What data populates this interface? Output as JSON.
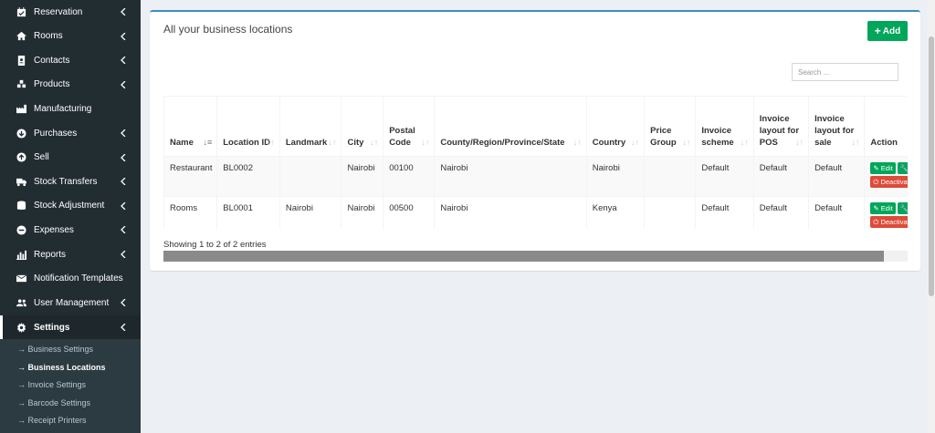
{
  "sidebar": {
    "items": [
      {
        "label": "Reservation",
        "icon": "calendar-check-icon"
      },
      {
        "label": "Rooms",
        "icon": "home-icon"
      },
      {
        "label": "Contacts",
        "icon": "address-book-icon"
      },
      {
        "label": "Products",
        "icon": "cubes-icon"
      },
      {
        "label": "Manufacturing",
        "icon": "industry-icon"
      },
      {
        "label": "Purchases",
        "icon": "arrow-circle-down-icon"
      },
      {
        "label": "Sell",
        "icon": "arrow-circle-up-icon"
      },
      {
        "label": "Stock Transfers",
        "icon": "truck-icon"
      },
      {
        "label": "Stock Adjustment",
        "icon": "database-icon"
      },
      {
        "label": "Expenses",
        "icon": "minus-circle-icon"
      },
      {
        "label": "Reports",
        "icon": "bar-chart-icon"
      },
      {
        "label": "Notification Templates",
        "icon": "envelope-icon"
      },
      {
        "label": "User Management",
        "icon": "users-icon"
      },
      {
        "label": "Settings",
        "icon": "cog-icon"
      }
    ],
    "subitems": [
      {
        "label": "→ Business Settings"
      },
      {
        "label": "→ Business Locations"
      },
      {
        "label": "→ Invoice Settings"
      },
      {
        "label": "→ Barcode Settings"
      },
      {
        "label": "→ Receipt Printers"
      }
    ]
  },
  "page": {
    "title": "All your business locations",
    "add_label": "Add",
    "search_placeholder": "Search ..."
  },
  "table": {
    "headers": [
      "Name",
      "Location ID",
      "Landmark",
      "City",
      "Postal Code",
      "County/Region/Province/State",
      "Country",
      "Price Group",
      "Invoice scheme",
      "Invoice layout for POS",
      "Invoice layout for sale",
      "Action"
    ],
    "rows": [
      {
        "cells": [
          "Restaurant",
          "BL0002",
          "",
          "Nairobi",
          "00100",
          "Nairobi",
          "Nairobi",
          "",
          "Default",
          "Default",
          "Default"
        ]
      },
      {
        "cells": [
          "Rooms",
          "BL0001",
          "Nairobi",
          "Nairobi",
          "00500",
          "Nairobi",
          "Kenya",
          "",
          "Default",
          "Default",
          "Default"
        ]
      }
    ],
    "action_labels": {
      "edit": "Edit",
      "settings": "Settings",
      "deactivate": "Deactivate Location"
    },
    "info": "Showing 1 to 2 of 2 entries"
  },
  "colors": {
    "sidebar_bg": "#222d32",
    "accent": "#3c8dbc",
    "success": "#00a65a",
    "danger": "#dd4b39"
  }
}
